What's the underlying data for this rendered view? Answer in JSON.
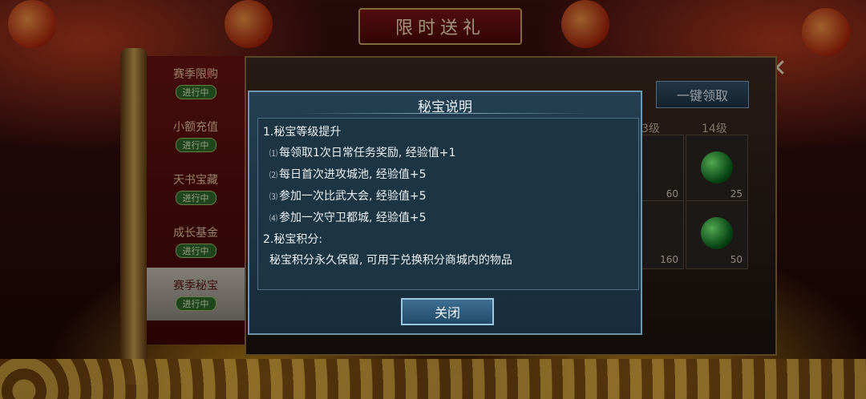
{
  "banner": {
    "title": "限时送礼"
  },
  "side_menu": {
    "items": [
      {
        "label": "赛季限购",
        "status": "进行中"
      },
      {
        "label": "小额充值",
        "status": "进行中"
      },
      {
        "label": "天书宝藏",
        "status": "进行中"
      },
      {
        "label": "成长基金",
        "status": "进行中"
      },
      {
        "label": "赛季秘宝",
        "status": "进行中"
      }
    ]
  },
  "panel": {
    "claim_all_label": "一键领取",
    "levels": [
      "3级",
      "14级"
    ],
    "slots": [
      "60",
      "25",
      "160",
      "50"
    ]
  },
  "dialog": {
    "title": "秘宝说明",
    "section1_heading": "1.秘宝等级提升",
    "rules": [
      {
        "idx": "⑴",
        "text": "每领取1次日常任务奖励, 经验值+1"
      },
      {
        "idx": "⑵",
        "text": "每日首次进攻城池, 经验值+5"
      },
      {
        "idx": "⑶",
        "text": "参加一次比武大会, 经验值+5"
      },
      {
        "idx": "⑷",
        "text": "参加一次守卫都城, 经验值+5"
      }
    ],
    "section2_heading": "2.秘宝积分:",
    "section2_text": "秘宝积分永久保留, 可用于兑换积分商城内的物品",
    "close_label": "关闭"
  }
}
